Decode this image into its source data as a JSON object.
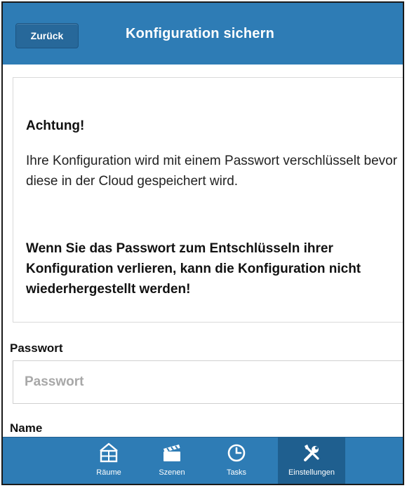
{
  "header": {
    "back_label": "Zurück",
    "title": "Konfiguration sichern"
  },
  "notice": {
    "heading": "Achtung!",
    "body": "Ihre Konfiguration wird mit einem Passwort verschlüsselt bevor diese in der Cloud gespeichert wird.",
    "warning": "Wenn Sie das Passwort zum Entschlüsseln ihrer Konfiguration verlieren, kann die Konfiguration nicht wiederhergestellt werden!"
  },
  "form": {
    "password_label": "Passwort",
    "password_placeholder": "Passwort",
    "password_value": "",
    "name_label": "Name"
  },
  "tabs": [
    {
      "label": "Räume",
      "icon": "rooms-icon",
      "active": false
    },
    {
      "label": "Szenen",
      "icon": "clapperboard-icon",
      "active": false
    },
    {
      "label": "Tasks",
      "icon": "clock-icon",
      "active": false
    },
    {
      "label": "Einstellungen",
      "icon": "tools-icon",
      "active": true
    }
  ],
  "colors": {
    "accent": "#2e7cb5",
    "accent_dark": "#1f5f8f"
  }
}
